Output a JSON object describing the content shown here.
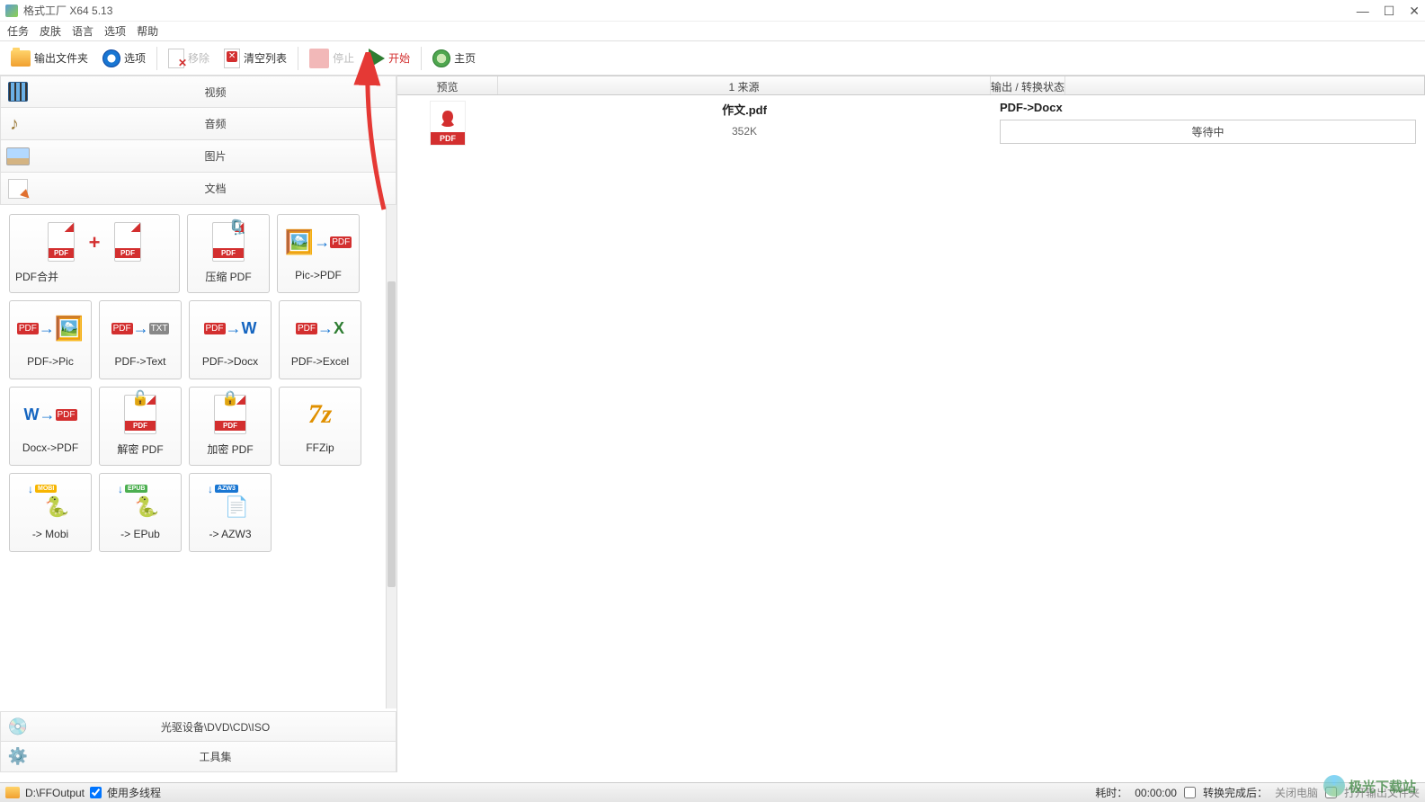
{
  "app": {
    "title": "格式工厂 X64 5.13"
  },
  "window_controls": {
    "min": "—",
    "max": "☐",
    "close": "✕"
  },
  "menu": [
    "任务",
    "皮肤",
    "语言",
    "选项",
    "帮助"
  ],
  "toolbar": {
    "output_folder": "输出文件夹",
    "options": "选项",
    "remove": "移除",
    "clear_list": "清空列表",
    "stop": "停止",
    "start": "开始",
    "home": "主页"
  },
  "categories": {
    "video": "视频",
    "audio": "音频",
    "image": "图片",
    "document": "文档",
    "optical": "光驱设备\\DVD\\CD\\ISO",
    "tools": "工具集"
  },
  "tiles": {
    "pdf_merge": "PDF合并",
    "compress_pdf": "压缩 PDF",
    "pic_to_pdf": "Pic->PDF",
    "pdf_to_pic": "PDF->Pic",
    "pdf_to_text": "PDF->Text",
    "pdf_to_docx": "PDF->Docx",
    "pdf_to_excel": "PDF->Excel",
    "docx_to_pdf": "Docx->PDF",
    "decrypt_pdf": "解密 PDF",
    "encrypt_pdf": "加密 PDF",
    "ffzip": "FFZip",
    "to_mobi": "-> Mobi",
    "to_epub": "-> EPub",
    "to_azw3": "-> AZW3"
  },
  "task_header": {
    "preview": "预览",
    "source": "1 来源",
    "output": "输出 / 转换状态"
  },
  "task": {
    "filename": "作文.pdf",
    "filesize": "352K",
    "conversion": "PDF->Docx",
    "status": "等待中",
    "thumb_label": "PDF"
  },
  "statusbar": {
    "path": "D:\\FFOutput",
    "multithread": "使用多线程",
    "elapsed_label": "耗时：",
    "elapsed_value": "00:00:00",
    "after_convert": "转换完成后：",
    "after_action1": "关闭电脑",
    "after_action2": "打开输出文件夹"
  },
  "watermark": {
    "text": "极光下载站"
  }
}
